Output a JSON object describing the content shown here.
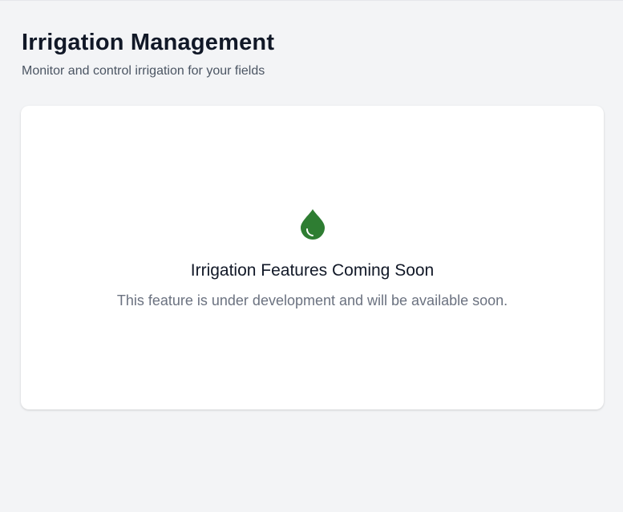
{
  "header": {
    "title": "Irrigation Management",
    "subtitle": "Monitor and control irrigation for your fields"
  },
  "empty_state": {
    "icon": "water-drop-icon",
    "icon_color": "#2e7d32",
    "title": "Irrigation Features Coming Soon",
    "message": "This feature is under development and will be available soon."
  }
}
